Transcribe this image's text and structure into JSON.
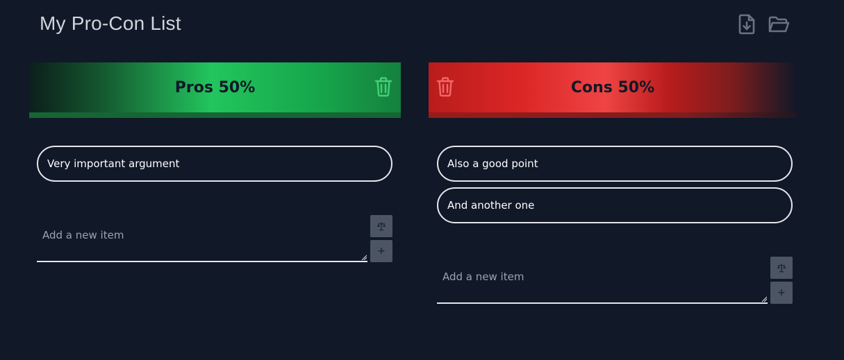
{
  "app": {
    "title": "My Pro-Con List"
  },
  "toolbar": {
    "icons": [
      "file-download-icon",
      "folder-open-icon"
    ]
  },
  "pros": {
    "header": "Pros 50%",
    "color": "#22c55e",
    "items": [
      "Very important argument"
    ],
    "new_item_placeholder": "Add a new item"
  },
  "cons": {
    "header": "Cons 50%",
    "color": "#ef4444",
    "items": [
      "Also a good point",
      "And another one"
    ],
    "new_item_placeholder": "Add a new item"
  },
  "buttons": {
    "weigh_icon": "scale-icon",
    "add_label": "+"
  }
}
